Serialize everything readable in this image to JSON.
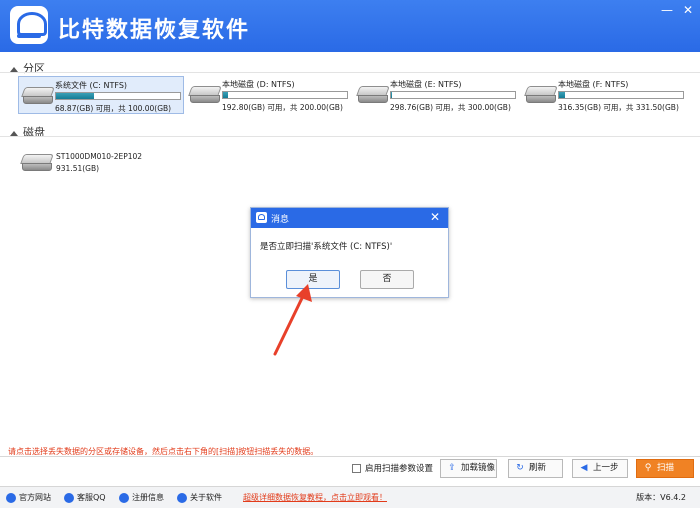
{
  "app": {
    "title": "比特数据恢复软件"
  },
  "window_controls": {
    "minimize": "—",
    "close": "✕"
  },
  "sections": {
    "partitions": "分区",
    "disks": "磁盘"
  },
  "partitions": [
    {
      "name": "系统文件 (C: NTFS)",
      "capacity": "68.87(GB) 可用，共 100.00(GB)",
      "used_fraction": 0.31,
      "selected": true
    },
    {
      "name": "本地磁盘 (D: NTFS)",
      "capacity": "192.80(GB) 可用，共 200.00(GB)",
      "used_fraction": 0.04,
      "selected": false
    },
    {
      "name": "本地磁盘 (E: NTFS)",
      "capacity": "298.76(GB) 可用，共 300.00(GB)",
      "used_fraction": 0.01,
      "selected": false
    },
    {
      "name": "本地磁盘 (F: NTFS)",
      "capacity": "316.35(GB) 可用，共 331.50(GB)",
      "used_fraction": 0.05,
      "selected": false
    }
  ],
  "disk": {
    "name": "ST1000DM010-2EP102",
    "capacity": "931.51(GB)"
  },
  "dialog": {
    "title": "消息",
    "message": "是否立即扫描'系统文件 (C: NTFS)'",
    "yes": "是",
    "no": "否",
    "close": "✕"
  },
  "hint": "请点击选择丢失数据的分区或存储设备，然后点击右下角的[扫描]按钮扫描丢失的数据。",
  "toolbar": {
    "scan_settings": "启用扫描参数设置",
    "load_image": "加载镜像",
    "refresh": "刷新",
    "prev": "上一步",
    "scan": "扫描"
  },
  "statusbar": {
    "website": "官方网站",
    "qq": "客服QQ",
    "register": "注册信息",
    "about": "关于软件",
    "promo": "超级详细数据恢复教程，点击立即观看！",
    "version": "版本：V6.4.2"
  },
  "colors": {
    "accent": "#2a6ae6",
    "scan": "#f08224",
    "hint": "#e23b1a",
    "arrow": "#e8402a"
  }
}
